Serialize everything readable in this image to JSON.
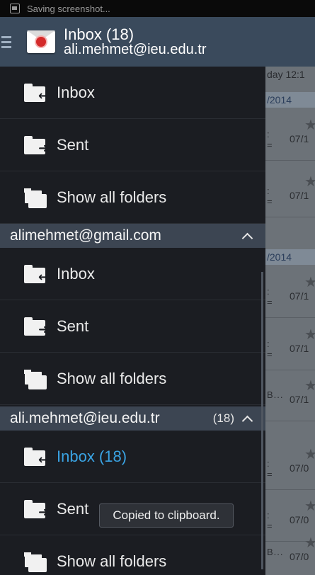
{
  "status_bar": {
    "text": "Saving screenshot..."
  },
  "action_bar": {
    "title": "Inbox (18)",
    "subtitle": "ali.mehmet@ieu.edu.tr"
  },
  "background_list": {
    "headers": [
      "day 12:1",
      "/2014",
      "/2014"
    ],
    "dates": [
      "07/1",
      "07/1",
      "07/1",
      "07/1",
      "07/1",
      "07/1",
      "07/0",
      "07/0",
      "07/0"
    ],
    "snippets": [
      "B...",
      "B..."
    ]
  },
  "drawer": {
    "local_items": [
      {
        "label": "Inbox",
        "icon": "inbox-folder-icon"
      },
      {
        "label": "Sent",
        "icon": "sent-folder-icon"
      },
      {
        "label": "Show all folders",
        "icon": "folders-icon"
      }
    ],
    "accounts": [
      {
        "name": "alimehmet@gmail.com",
        "count": "",
        "items": [
          {
            "label": "Inbox",
            "icon": "inbox-folder-icon"
          },
          {
            "label": "Sent",
            "icon": "sent-folder-icon"
          },
          {
            "label": "Show all folders",
            "icon": "folders-icon"
          }
        ]
      },
      {
        "name": "ali.mehmet@ieu.edu.tr",
        "count": "(18)",
        "items": [
          {
            "label": "Inbox (18)",
            "icon": "inbox-folder-icon",
            "active": true
          },
          {
            "label": "Sent",
            "icon": "sent-folder-icon"
          },
          {
            "label": "Show all folders",
            "icon": "folders-icon"
          }
        ]
      }
    ]
  },
  "toast": {
    "text": "Copied to clipboard."
  },
  "colors": {
    "accent": "#3aa3e3",
    "action_bar": "#3a4a5c",
    "drawer_bg": "#1b1d22",
    "section_header": "#3c4552"
  }
}
